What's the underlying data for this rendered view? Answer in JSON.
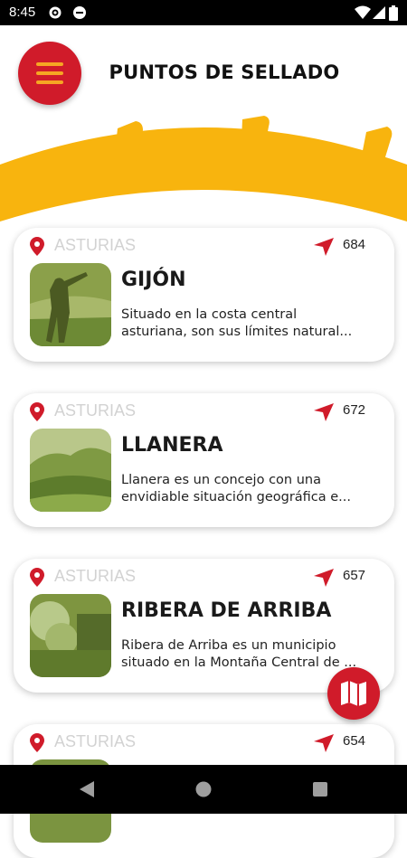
{
  "status_bar": {
    "time": "8:45",
    "icons": [
      "gear-icon",
      "circle-icon",
      "wifi-icon",
      "signal-icon",
      "battery-icon"
    ]
  },
  "header": {
    "title": "PUNTOS DE SELLADO",
    "menu_icon": "hamburger-icon"
  },
  "colors": {
    "brand_red": "#d01b2a",
    "sun_yellow": "#f8b40e",
    "region_gray": "#d2d2d2"
  },
  "cards": [
    {
      "region": "ASTURIAS",
      "distance": "684",
      "name": "GIJÓN",
      "desc_line1": "Situado en la costa central",
      "desc_line2": "asturiana, son sus límites natural..."
    },
    {
      "region": "ASTURIAS",
      "distance": "672",
      "name": "LLANERA",
      "desc_line1": "Llanera es un concejo con una",
      "desc_line2": "envidiable situación geográfica e..."
    },
    {
      "region": "ASTURIAS",
      "distance": "657",
      "name": "RIBERA DE ARRIBA",
      "desc_line1": "Ribera de Arriba es un municipio",
      "desc_line2": "situado en la Montaña Central de ..."
    },
    {
      "region": "ASTURIAS",
      "distance": "654"
    }
  ],
  "fab": {
    "icon": "map-icon"
  },
  "nav_bar": {
    "icons": [
      "back-icon",
      "home-icon",
      "recents-icon"
    ]
  }
}
